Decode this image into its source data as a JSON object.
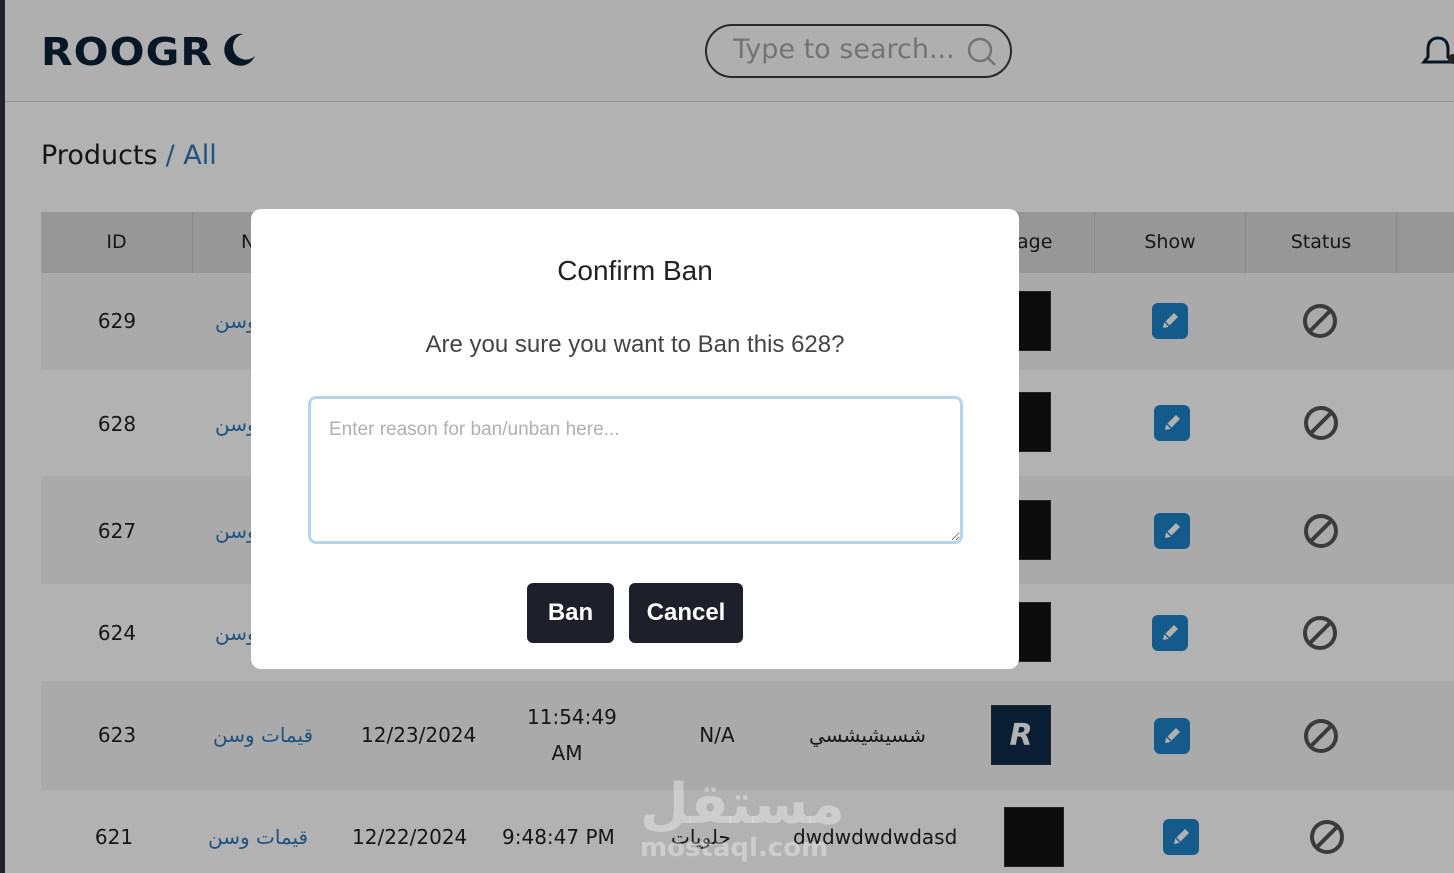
{
  "header": {
    "logo": "ROOGR",
    "search_placeholder": "Type to search..."
  },
  "breadcrumb": {
    "title": "Products",
    "sub": "/ All"
  },
  "table": {
    "columns": [
      "ID",
      "N",
      "",
      "",
      "",
      "",
      "age",
      "Show",
      "Status"
    ],
    "rows": [
      {
        "id": "629",
        "name": "وسن",
        "date": "",
        "time_a": "",
        "time_b": "",
        "category": "",
        "desc": ""
      },
      {
        "id": "628",
        "name": "وسن",
        "date": "",
        "time_a": "",
        "time_b": "",
        "category": "",
        "desc": ""
      },
      {
        "id": "627",
        "name": "وسن",
        "date": "",
        "time_a": "",
        "time_b": "",
        "category": "",
        "desc": ""
      },
      {
        "id": "624",
        "name": "وسن",
        "date": "",
        "time_a": "",
        "time_b": "",
        "category": "",
        "desc": ""
      },
      {
        "id": "623",
        "name": "قيمات وسن",
        "date": "12/23/2024",
        "time_a": "11:54:49",
        "time_b": "AM",
        "category": "N/A",
        "desc": "شسيشيشسي"
      },
      {
        "id": "621",
        "name": "قيمات وسن",
        "date": "12/22/2024",
        "time_a": "9:48:47 PM",
        "time_b": "",
        "category": "حلويات",
        "desc": "dwdwdwdwdasd"
      }
    ]
  },
  "modal": {
    "title": "Confirm Ban",
    "message": "Are you sure you want to Ban this 628?",
    "placeholder": "Enter reason for ban/unban here...",
    "ban_label": "Ban",
    "cancel_label": "Cancel"
  },
  "watermark": {
    "text": "مستقل",
    "domain": "mostaql.com"
  },
  "colors": {
    "accent": "#1e82c8",
    "dark": "#1d1f2a",
    "link": "#2b78b8"
  }
}
